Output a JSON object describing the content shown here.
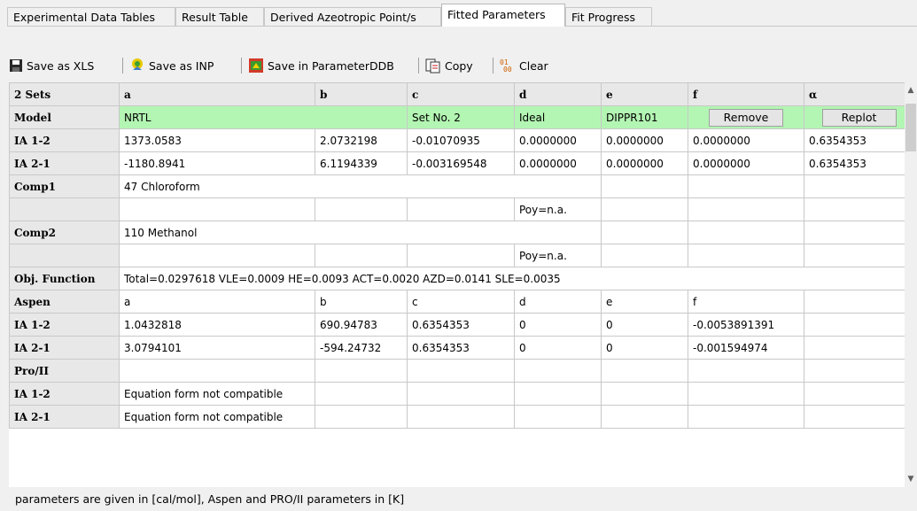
{
  "tabs": [
    {
      "label": "Experimental Data Tables"
    },
    {
      "label": "Result Table"
    },
    {
      "label": "Derived Azeotropic Point/s"
    },
    {
      "label": "Fitted Parameters"
    },
    {
      "label": "Fit Progress"
    }
  ],
  "active_tab": "Fitted Parameters",
  "toolbar": {
    "save_xls": "Save as XLS",
    "save_inp": "Save as INP",
    "save_ddb": "Save in ParameterDDB",
    "copy": "Copy",
    "clear": "Clear"
  },
  "grid": {
    "header": [
      "2 Sets",
      "a",
      "b",
      "c",
      "d",
      "e",
      "f",
      "α"
    ],
    "model": {
      "label": "Model",
      "a": "NRTL",
      "c": "Set No. 2",
      "d": "Ideal",
      "e": "DIPPR101",
      "f_button": "Remove",
      "alpha_button": "Replot"
    },
    "ia12": {
      "label": "IA 1-2",
      "values": [
        "1373.0583",
        "2.0732198",
        "-0.01070935",
        "0.0000000",
        "0.0000000",
        "0.0000000",
        "0.6354353"
      ]
    },
    "ia21": {
      "label": "IA 2-1",
      "values": [
        "-1180.8941",
        "6.1194339",
        "-0.003169548",
        "0.0000000",
        "0.0000000",
        "0.0000000",
        "0.6354353"
      ]
    },
    "comp1": {
      "label": "Comp1",
      "value": "47 Chloroform",
      "poy": "Poy=n.a."
    },
    "comp2": {
      "label": "Comp2",
      "value": "110 Methanol",
      "poy": "Poy=n.a."
    },
    "objfn": {
      "label": "Obj. Function",
      "value": "Total=0.0297618 VLE=0.0009 HE=0.0093 ACT=0.0020 AZD=0.0141 SLE=0.0035"
    },
    "aspen": {
      "label": "Aspen",
      "cols": [
        "a",
        "b",
        "c",
        "d",
        "e",
        "f"
      ]
    },
    "aspen_ia12": {
      "label": "IA 1-2",
      "values": [
        "1.0432818",
        "690.94783",
        "0.6354353",
        "0",
        "0",
        "-0.0053891391"
      ]
    },
    "aspen_ia21": {
      "label": "IA 2-1",
      "values": [
        "3.0794101",
        "-594.24732",
        "0.6354353",
        "0",
        "0",
        "-0.001594974"
      ]
    },
    "proii": {
      "label": "Pro/II"
    },
    "proii_ia12": {
      "label": "IA 1-2",
      "value": "Equation form not compatible"
    },
    "proii_ia21": {
      "label": "IA 2-1",
      "value": "Equation form not compatible"
    }
  },
  "footer": "parameters are given in [cal/mol], Aspen and PRO/II parameters in [K]",
  "colors": {
    "model_row": "#b3f5b3",
    "header": "#e8e8e8"
  }
}
